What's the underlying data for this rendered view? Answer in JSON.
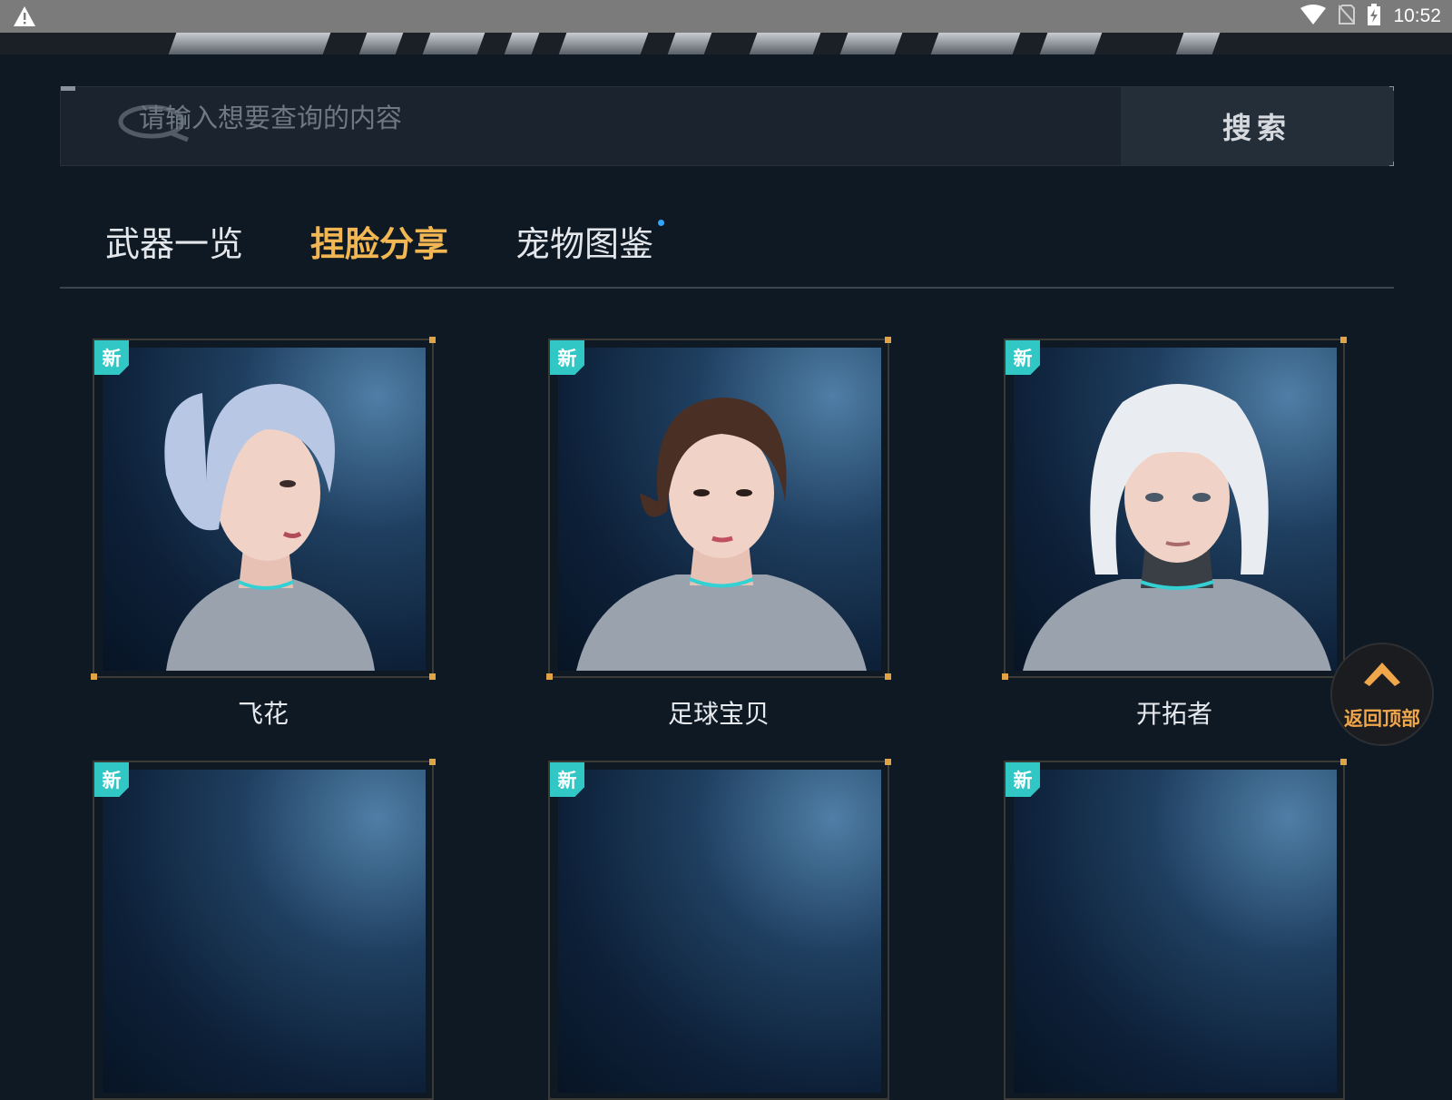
{
  "status_bar": {
    "time": "10:52"
  },
  "search": {
    "placeholder": "请输入想要查询的内容",
    "button_label": "搜索"
  },
  "tabs": [
    {
      "label": "武器一览",
      "active": false
    },
    {
      "label": "捏脸分享",
      "active": true
    },
    {
      "label": "宠物图鉴",
      "active": false,
      "has_dot": true
    }
  ],
  "cards": [
    {
      "badge": "新",
      "name": "飞花"
    },
    {
      "badge": "新",
      "name": "足球宝贝"
    },
    {
      "badge": "新",
      "name": "开拓者"
    },
    {
      "badge": "新",
      "name": ""
    },
    {
      "badge": "新",
      "name": ""
    },
    {
      "badge": "新",
      "name": ""
    }
  ],
  "back_to_top": {
    "label": "返回顶部"
  },
  "colors": {
    "accent": "#f2b653",
    "badge": "#31c7c4",
    "background": "#0f1923",
    "tab_dot": "#2ea8ff"
  }
}
